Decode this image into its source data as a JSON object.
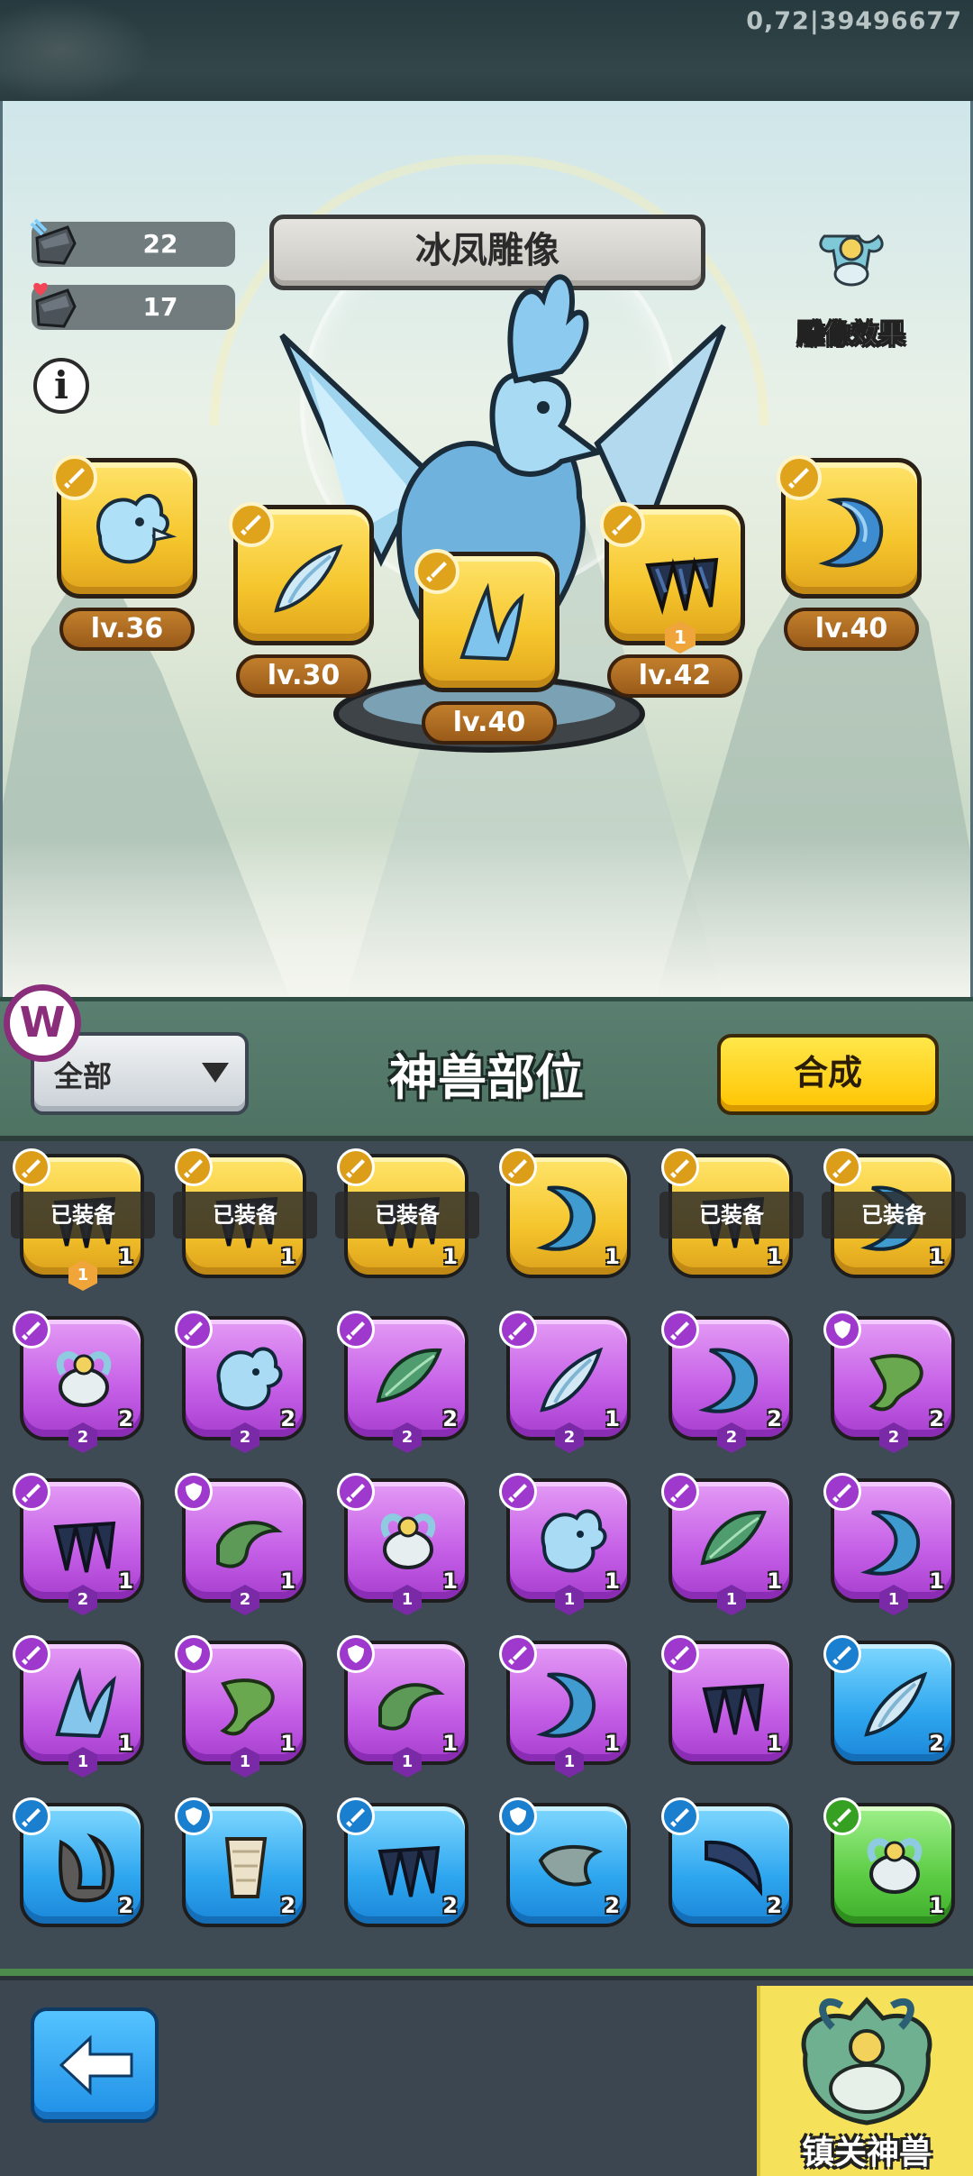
{
  "status": {
    "version_text": "0,72|39496677"
  },
  "statue": {
    "title": "冰凤雕像",
    "stats": [
      {
        "icon": "attack-ore-icon",
        "value": "22"
      },
      {
        "icon": "health-ore-icon",
        "value": "17"
      }
    ],
    "effect_label": "雕像效果",
    "slots": [
      {
        "part": "head",
        "level": "lv.36"
      },
      {
        "part": "wing",
        "level": "lv.30"
      },
      {
        "part": "crest",
        "level": "lv.40"
      },
      {
        "part": "claw",
        "level": "lv.42",
        "star": "1"
      },
      {
        "part": "tail",
        "level": "lv.40"
      }
    ]
  },
  "filter": {
    "selected": "全部",
    "section_title": "神兽部位",
    "synth_label": "合成"
  },
  "inventory": {
    "equipped_label": "已装备",
    "rows": [
      [
        {
          "rarity": "gold",
          "icon": "claw",
          "count": "1",
          "star": "1",
          "equipped": true
        },
        {
          "rarity": "gold",
          "icon": "claw",
          "count": "1",
          "equipped": true
        },
        {
          "rarity": "gold",
          "icon": "claw",
          "count": "1",
          "equipped": true
        },
        {
          "rarity": "gold",
          "icon": "tail",
          "count": "1"
        },
        {
          "rarity": "gold",
          "icon": "claw",
          "count": "1",
          "equipped": true
        },
        {
          "rarity": "gold",
          "icon": "tail",
          "count": "1",
          "equipped": true
        }
      ],
      [
        {
          "rarity": "purple",
          "icon": "ram",
          "count": "2",
          "star": "2"
        },
        {
          "rarity": "purple",
          "icon": "head",
          "count": "2",
          "star": "2"
        },
        {
          "rarity": "purple",
          "icon": "leaf-wing",
          "count": "2",
          "star": "2"
        },
        {
          "rarity": "purple",
          "icon": "wing",
          "count": "1",
          "star": "2"
        },
        {
          "rarity": "purple",
          "icon": "tail",
          "count": "2",
          "star": "2"
        },
        {
          "rarity": "purple",
          "icon": "green-tail",
          "count": "2",
          "star": "2",
          "shield": true
        }
      ],
      [
        {
          "rarity": "purple",
          "icon": "claw",
          "count": "1",
          "star": "2"
        },
        {
          "rarity": "purple",
          "icon": "green-horn",
          "count": "1",
          "star": "2",
          "shield": true
        },
        {
          "rarity": "purple",
          "icon": "ram",
          "count": "1",
          "star": "1"
        },
        {
          "rarity": "purple",
          "icon": "head",
          "count": "1",
          "star": "1"
        },
        {
          "rarity": "purple",
          "icon": "leaf-wing",
          "count": "1",
          "star": "1"
        },
        {
          "rarity": "purple",
          "icon": "tail",
          "count": "1",
          "star": "1"
        }
      ],
      [
        {
          "rarity": "purple",
          "icon": "crest",
          "count": "1",
          "star": "1"
        },
        {
          "rarity": "purple",
          "icon": "green-tail",
          "count": "1",
          "star": "1",
          "shield": true
        },
        {
          "rarity": "purple",
          "icon": "green-horn",
          "count": "1",
          "star": "1",
          "shield": true
        },
        {
          "rarity": "purple",
          "icon": "tail",
          "count": "1",
          "star": "1"
        },
        {
          "rarity": "purple",
          "icon": "claw",
          "count": "1"
        },
        {
          "rarity": "blue",
          "icon": "wing",
          "count": "2"
        }
      ],
      [
        {
          "rarity": "blue",
          "icon": "horn",
          "count": "2"
        },
        {
          "rarity": "blue",
          "icon": "scroll",
          "count": "2",
          "shield": true
        },
        {
          "rarity": "blue",
          "icon": "claw",
          "count": "2"
        },
        {
          "rarity": "blue",
          "icon": "horn-gray",
          "count": "2",
          "shield": true
        },
        {
          "rarity": "blue",
          "icon": "fang",
          "count": "2"
        },
        {
          "rarity": "green",
          "icon": "ram",
          "count": "1"
        }
      ]
    ]
  },
  "bottom": {
    "guardian_label": "镇关神兽"
  }
}
